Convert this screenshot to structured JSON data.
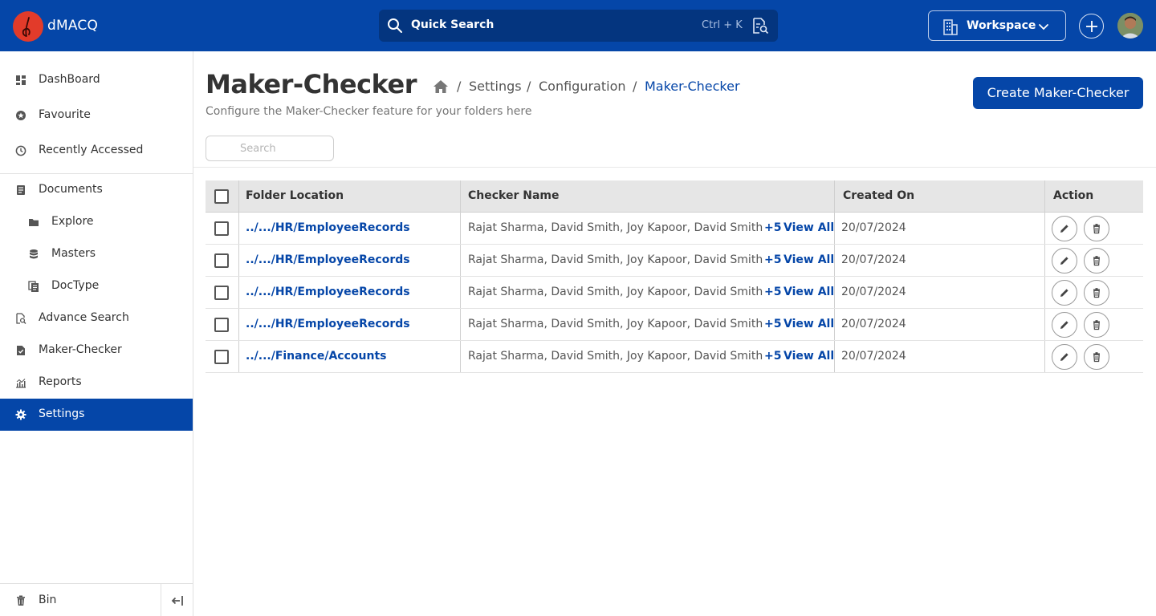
{
  "app": {
    "brand": "dMACQ",
    "quick_search": {
      "label": "Quick Search",
      "shortcut": "Ctrl + K"
    },
    "workspace": {
      "label": "Workspace"
    }
  },
  "sidebar": {
    "items": [
      {
        "label": "DashBoard",
        "icon": "dashboard-icon"
      },
      {
        "label": "Favourite",
        "icon": "star-icon"
      },
      {
        "label": "Recently Accessed",
        "icon": "clock-icon"
      },
      {
        "label": "Documents",
        "icon": "document-icon"
      },
      {
        "label": "Explore",
        "icon": "folder-icon"
      },
      {
        "label": "Masters",
        "icon": "database-icon"
      },
      {
        "label": "DocType",
        "icon": "doctype-icon"
      },
      {
        "label": "Advance Search",
        "icon": "advance-search-icon"
      },
      {
        "label": "Maker-Checker",
        "icon": "maker-checker-icon"
      },
      {
        "label": "Reports",
        "icon": "reports-icon"
      },
      {
        "label": "Settings",
        "icon": "settings-icon",
        "active": true
      }
    ],
    "bin": {
      "label": "Bin"
    }
  },
  "page": {
    "title": "Maker-Checker",
    "subtitle": "Configure the Maker-Checker feature for your folders here",
    "breadcrumb": [
      "Settings",
      "Configuration",
      "Maker-Checker"
    ],
    "create_button": "Create Maker-Checker",
    "search_placeholder": "Search"
  },
  "table": {
    "columns": [
      "Folder Location",
      "Checker Name",
      "Created On",
      "Action"
    ],
    "rows": [
      {
        "folder": "../.../HR/EmployeeRecords",
        "checkers": "Rajat Sharma, David Smith, Joy Kapoor, David Smith",
        "more": "+5",
        "view_all": "View All",
        "created": "20/07/2024"
      },
      {
        "folder": "../.../HR/EmployeeRecords",
        "checkers": "Rajat Sharma, David Smith, Joy Kapoor, David Smith",
        "more": "+5",
        "view_all": "View All",
        "created": "20/07/2024"
      },
      {
        "folder": "../.../HR/EmployeeRecords",
        "checkers": "Rajat Sharma, David Smith, Joy Kapoor, David Smith",
        "more": "+5",
        "view_all": "View All",
        "created": "20/07/2024"
      },
      {
        "folder": "../.../HR/EmployeeRecords",
        "checkers": "Rajat Sharma, David Smith, Joy Kapoor, David Smith",
        "more": "+5",
        "view_all": "View All",
        "created": "20/07/2024"
      },
      {
        "folder": "../.../Finance/Accounts",
        "checkers": "Rajat Sharma, David Smith, Joy Kapoor, David Smith",
        "more": "+5",
        "view_all": "View All",
        "created": "20/07/2024"
      }
    ]
  },
  "colors": {
    "primary": "#0546a8",
    "topbar": "#0546a8",
    "logo": "#e23b2a"
  }
}
